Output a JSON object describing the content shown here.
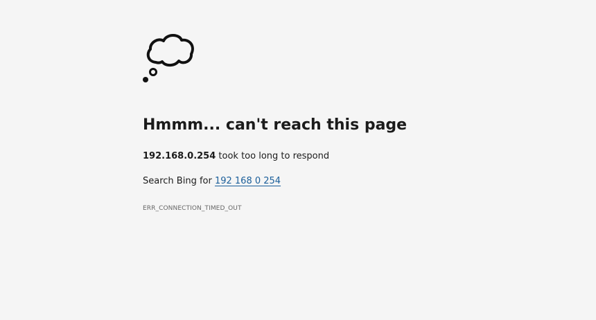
{
  "error_page": {
    "icon": "thought-cloud-icon",
    "title": "Hmmm... can't reach this page",
    "host": "192.168.0.254",
    "message_suffix": " took too long to respond",
    "search_prefix": "Search Bing for ",
    "search_query": "192 168 0 254",
    "error_code": "ERR_CONNECTION_TIMED_OUT"
  },
  "colors": {
    "background": "#f5f5f5",
    "text": "#1b1b1b",
    "link": "#1a5e9a",
    "muted": "#666666"
  }
}
